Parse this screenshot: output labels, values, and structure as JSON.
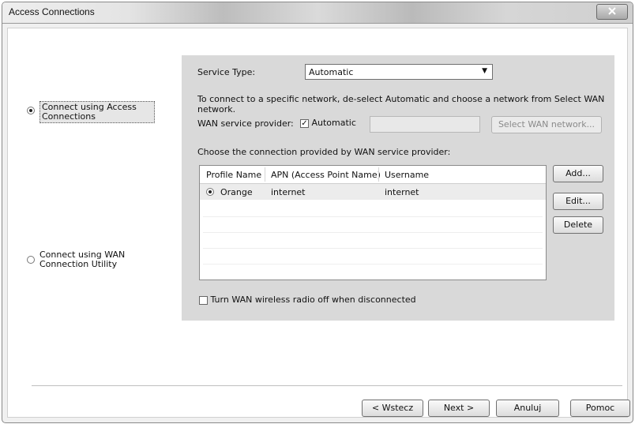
{
  "window": {
    "title": "Access Connections"
  },
  "left": {
    "option1": {
      "line1": "Connect using Access",
      "line2": "Connections",
      "selected": true
    },
    "option2": {
      "line1": "Connect using WAN",
      "line2": "Connection Utility",
      "selected": false
    }
  },
  "panel": {
    "service_type_label": "Service Type:",
    "service_type_value": "Automatic",
    "info_line1": "To connect to a specific network, de-select Automatic and choose a network from Select WAN",
    "info_line2": "network.",
    "wan_provider_label": "WAN service provider:",
    "automatic_checkbox_label": "Automatic",
    "automatic_checked": true,
    "select_wan_button": "Select WAN network...",
    "choose_label": "Choose the connection provided by WAN service provider:",
    "table": {
      "columns": [
        "Profile Name",
        "APN (Access Point Name)",
        "Username"
      ],
      "rows": [
        {
          "profile": "Orange",
          "apn": "internet",
          "username": "internet",
          "selected": true
        }
      ]
    },
    "add_button": "Add...",
    "edit_button": "Edit...",
    "delete_button": "Delete",
    "turn_off_label": "Turn WAN wireless radio off when disconnected",
    "turn_off_checked": false
  },
  "footer": {
    "back": "< Wstecz",
    "next": "Next >",
    "cancel": "Anuluj",
    "help": "Pomoc"
  }
}
